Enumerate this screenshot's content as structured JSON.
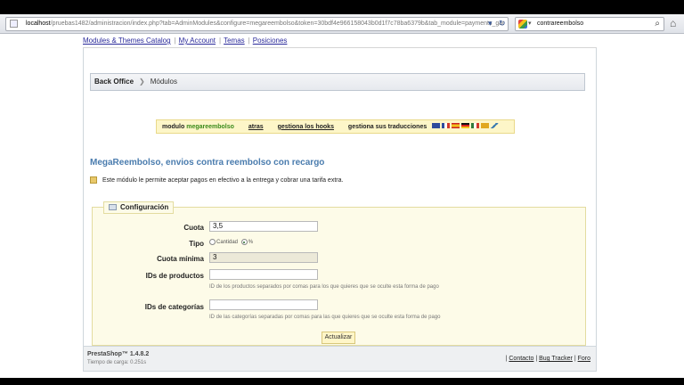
{
  "browser": {
    "url_host": "localhost",
    "url_rest": "/pruebas1482/administracion/index.php?tab=AdminModules&configure=megareembolso&token=30bdf4e966158043b0d1f7c78ba6379b&tab_module=payments_gat",
    "search_value": "contrareembolso"
  },
  "menu": {
    "items": [
      "Modules & Themes Catalog",
      "My Account",
      "Temas",
      "Posiciones"
    ]
  },
  "breadcrumb": {
    "root": "Back Office",
    "current": "Módulos"
  },
  "module_bar": {
    "prefix": "modulo",
    "module_name": "megareembolso",
    "back": "atras",
    "hooks": "gestiona los hooks",
    "translations": "gestiona sus traducciones"
  },
  "module": {
    "title": "MegaReembolso, envios contra reembolso con recargo",
    "description": "Este módulo le permite aceptar pagos en efectivo a la entrega y cobrar una tarifa extra."
  },
  "config": {
    "legend": "Configuración",
    "cuota_label": "Cuota",
    "cuota_value": "3,5",
    "tipo_label": "Tipo",
    "tipo_opt1": "Cantidad",
    "tipo_opt2": "%",
    "cuota_min_label": "Cuota mínima",
    "cuota_min_value": "3",
    "ids_prod_label": "IDs de productos",
    "ids_prod_help": "ID de los productos separados por comas para los que quieres que se oculte esta forma de pago",
    "ids_cat_label": "IDs de categorías",
    "ids_cat_help": "ID de las categorías separadas por comas para las que quieres que se oculte esta forma de pago",
    "submit": "Actualizar"
  },
  "footer": {
    "version": "PrestaShop™ 1.4.8.2",
    "load_time": "Tiempo de carga: 0.251s",
    "contact": "Contacto",
    "bug": "Bug Tracker",
    "forum": "Foro"
  },
  "flag_colors": [
    "#2f4c9c",
    "#d33a2a",
    "#e1a81e",
    "#2f7a3a",
    "#c94a2a"
  ]
}
